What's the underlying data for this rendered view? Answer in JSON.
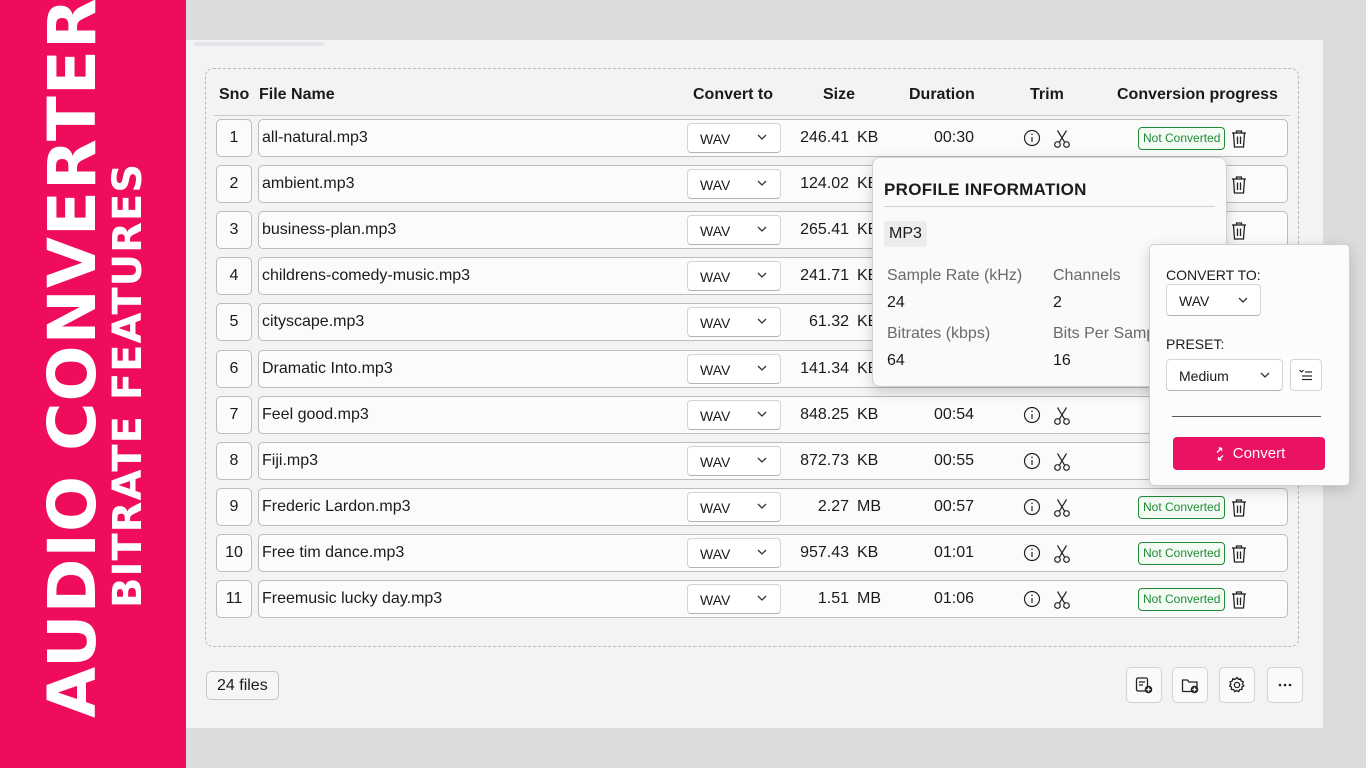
{
  "banner": {
    "title": "AUDIO CONVERTER",
    "subtitle": "BITRATE FEATURES"
  },
  "table": {
    "headers": {
      "sno": "Sno",
      "file_name": "File Name",
      "convert_to": "Convert to",
      "size": "Size",
      "duration": "Duration",
      "trim": "Trim",
      "progress": "Conversion progress"
    },
    "rows": [
      {
        "sno": "1",
        "name": "all-natural.mp3",
        "format": "WAV",
        "size": "246.41",
        "unit": "KB",
        "duration": "00:30",
        "status": "Not Converted"
      },
      {
        "sno": "2",
        "name": "ambient.mp3",
        "format": "WAV",
        "size": "124.02",
        "unit": "KB",
        "duration": "",
        "status": ""
      },
      {
        "sno": "3",
        "name": "business-plan.mp3",
        "format": "WAV",
        "size": "265.41",
        "unit": "KB",
        "duration": "",
        "status": ""
      },
      {
        "sno": "4",
        "name": "childrens-comedy-music.mp3",
        "format": "WAV",
        "size": "241.71",
        "unit": "KB",
        "duration": "",
        "status": ""
      },
      {
        "sno": "5",
        "name": "cityscape.mp3",
        "format": "WAV",
        "size": "61.32",
        "unit": "KB",
        "duration": "",
        "status": ""
      },
      {
        "sno": "6",
        "name": "Dramatic Into.mp3",
        "format": "WAV",
        "size": "141.34",
        "unit": "KB",
        "duration": "",
        "status": ""
      },
      {
        "sno": "7",
        "name": "Feel good.mp3",
        "format": "WAV",
        "size": "848.25",
        "unit": "KB",
        "duration": "00:54",
        "status": ""
      },
      {
        "sno": "8",
        "name": "Fiji.mp3",
        "format": "WAV",
        "size": "872.73",
        "unit": "KB",
        "duration": "00:55",
        "status": ""
      },
      {
        "sno": "9",
        "name": "Frederic Lardon.mp3",
        "format": "WAV",
        "size": "2.27",
        "unit": "MB",
        "duration": "00:57",
        "status": "Not Converted"
      },
      {
        "sno": "10",
        "name": "Free tim dance.mp3",
        "format": "WAV",
        "size": "957.43",
        "unit": "KB",
        "duration": "01:01",
        "status": "Not Converted"
      },
      {
        "sno": "11",
        "name": "Freemusic lucky day.mp3",
        "format": "WAV",
        "size": "1.51",
        "unit": "MB",
        "duration": "01:06",
        "status": "Not Converted"
      }
    ]
  },
  "footer": {
    "file_count": "24 files"
  },
  "profile": {
    "title": "PROFILE INFORMATION",
    "format": "MP3",
    "sample_rate_label": "Sample Rate (kHz)",
    "sample_rate": "24",
    "channels_label": "Channels",
    "channels": "2",
    "bitrate_label": "Bitrates (kbps)",
    "bitrate": "64",
    "bits_label": "Bits Per Samp",
    "bits": "16"
  },
  "convert_panel": {
    "convert_to_label": "CONVERT TO:",
    "convert_to_value": "WAV",
    "preset_label": "PRESET:",
    "preset_value": "Medium",
    "convert_button": "Convert"
  },
  "colors": {
    "accent": "#ea1263",
    "banner": "#f00c5c",
    "status_green": "#1f8b35"
  },
  "icons": [
    "info-icon",
    "scissors-icon",
    "trash-icon",
    "chevron-down-icon",
    "add-file-icon",
    "add-folder-icon",
    "settings-icon",
    "more-icon",
    "list-settings-icon",
    "convert-icon"
  ]
}
